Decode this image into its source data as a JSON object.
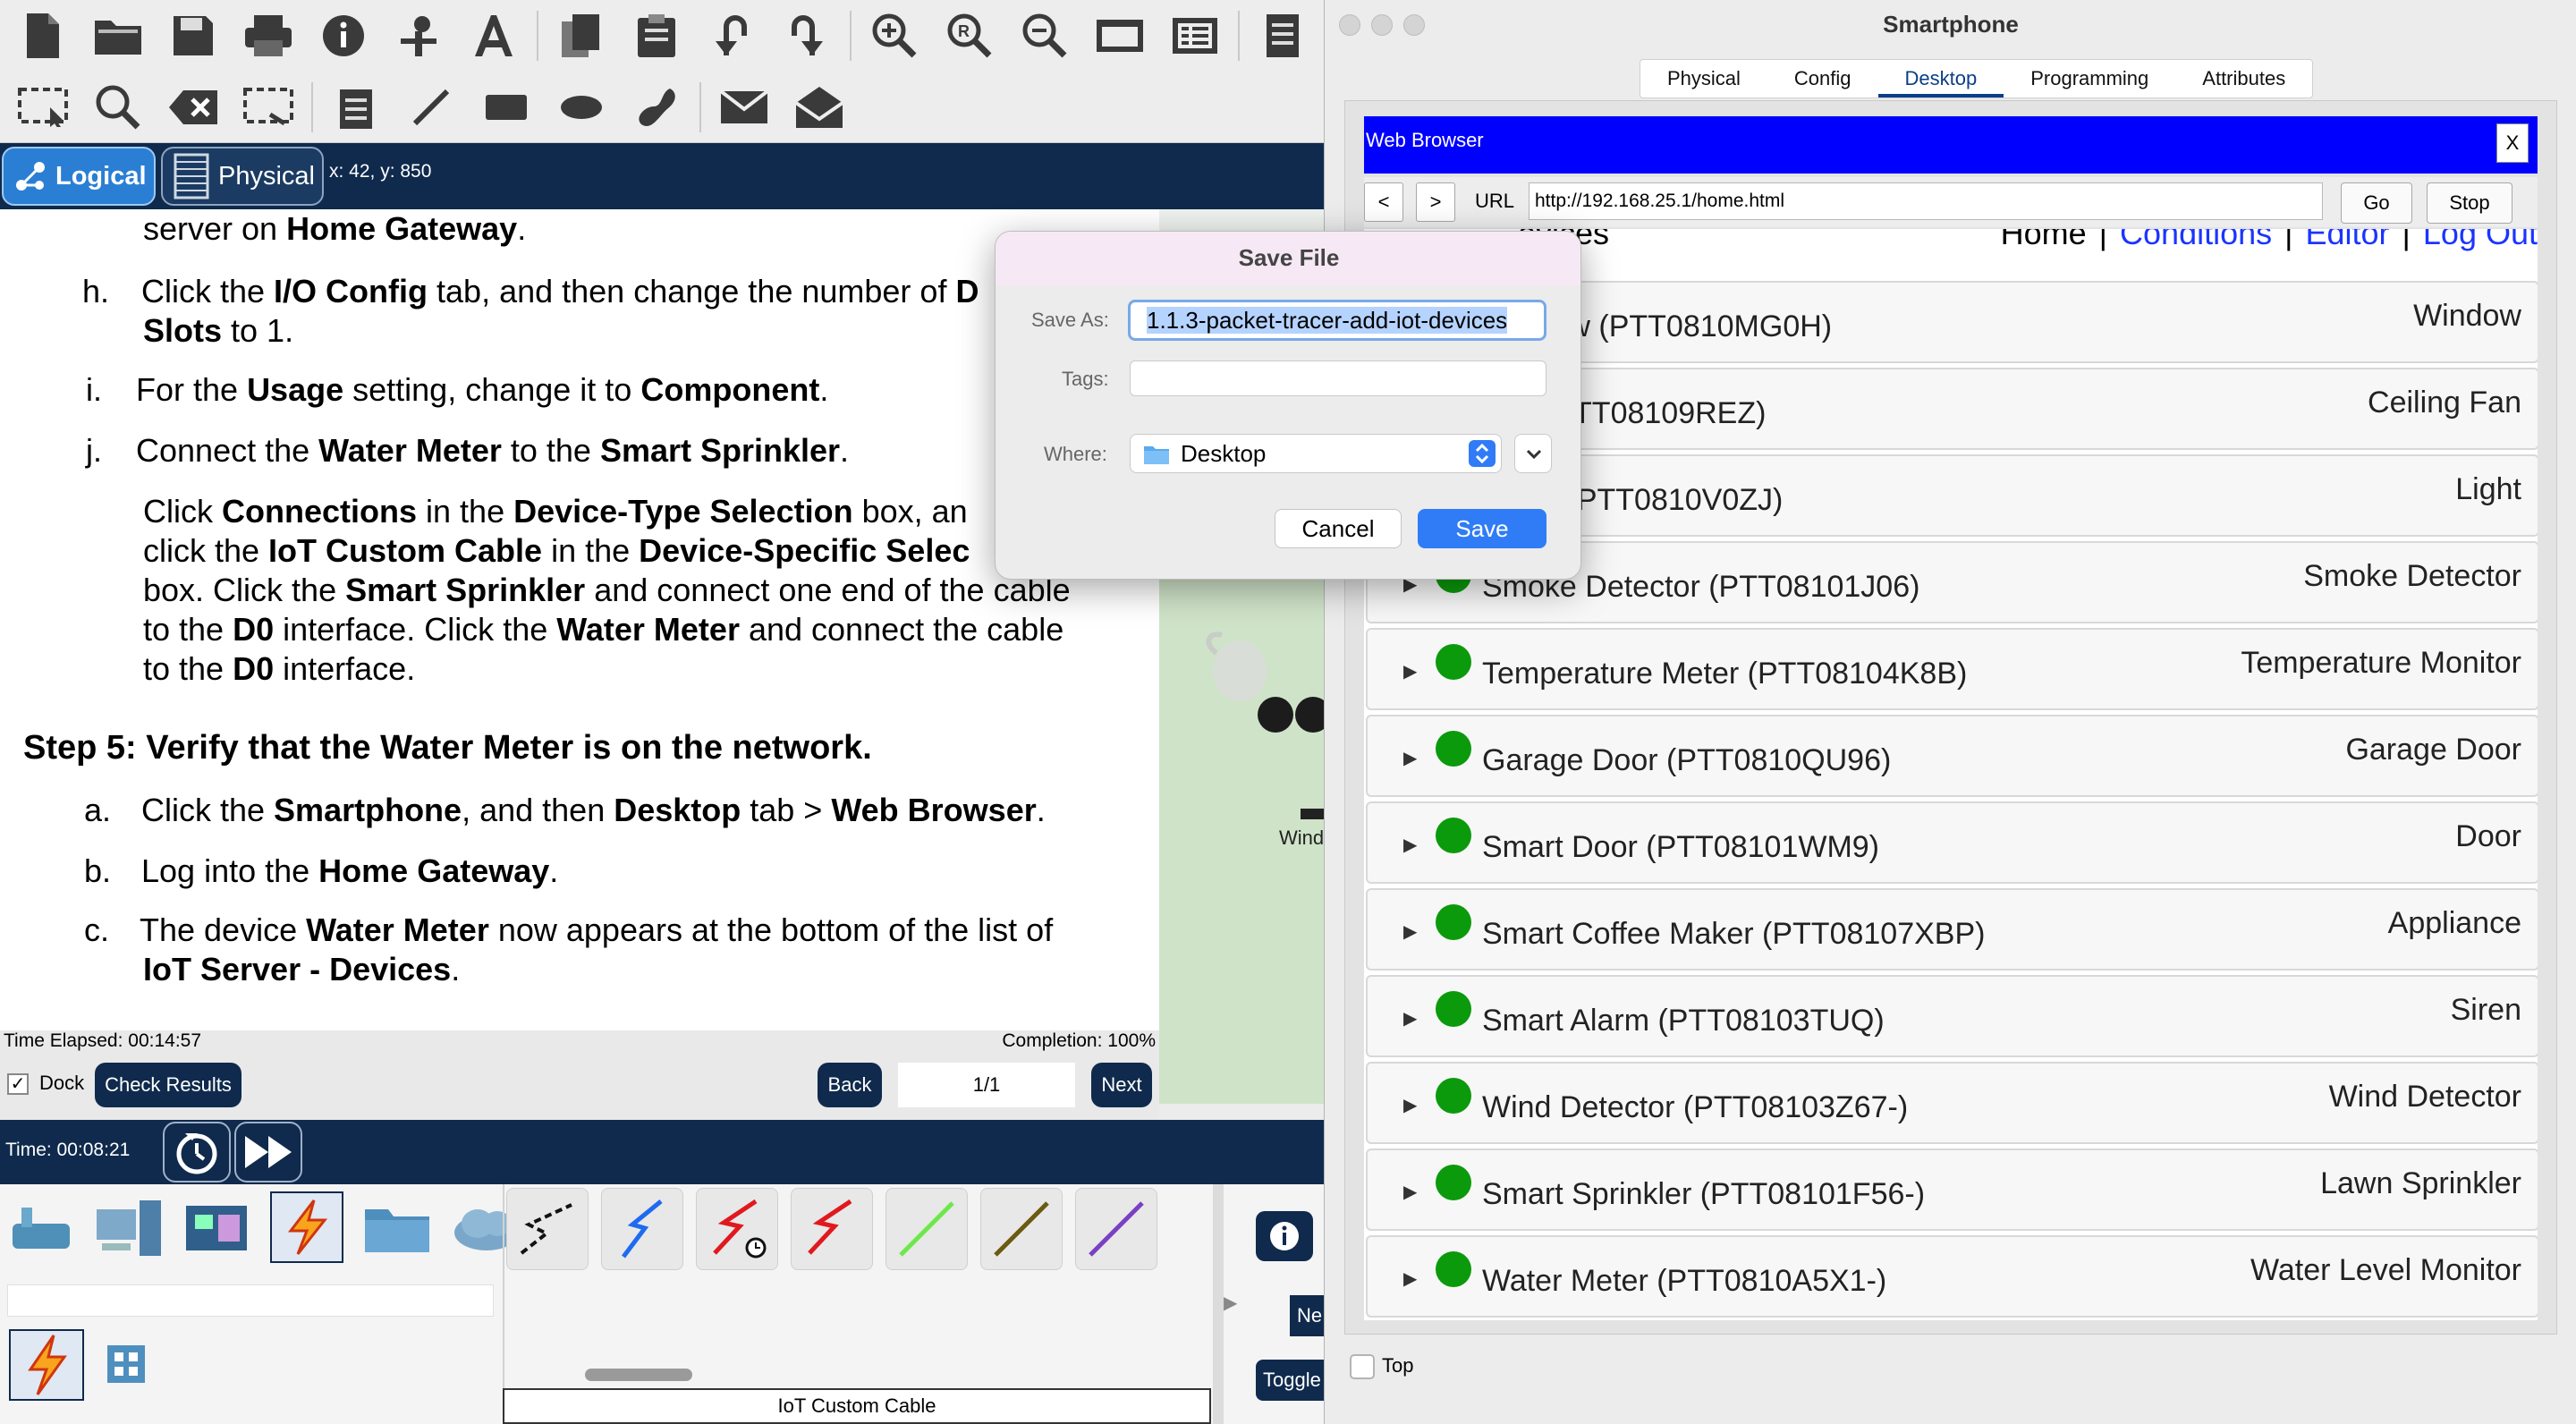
{
  "toolbar": {
    "row1_icons": [
      "new-file-icon",
      "open-folder-icon",
      "save-icon",
      "print-icon",
      "info-icon",
      "activity-wizard-icon",
      "font-tool-icon",
      "copy-icon",
      "paste-icon",
      "undo-icon",
      "redo-icon",
      "zoom-in-icon",
      "zoom-reset-icon",
      "zoom-out-icon",
      "window-icon",
      "palette-icon",
      "note-icon"
    ],
    "row2_icons": [
      "select-icon",
      "inspect-icon",
      "delete-icon",
      "resize-icon",
      "note-tool-icon",
      "line-icon",
      "rectangle-icon",
      "ellipse-icon",
      "freeform-icon",
      "add-simple-pdu-icon",
      "add-complex-pdu-icon"
    ]
  },
  "navbar": {
    "logical_label": "Logical",
    "physical_label": "Physical",
    "coords": "x: 42, y: 850"
  },
  "instructions": {
    "l1a": "server on ",
    "l1b": "Home Gateway",
    "l1c": ".",
    "h_letter": "h.",
    "h_a": "Click the ",
    "h_b": "I/O Config",
    "h_c": " tab, and then change the number of ",
    "h_d": "D",
    "h2_a": "Slots",
    "h2_b": " to 1.",
    "i_letter": "i.",
    "i_a": "For the ",
    "i_b": "Usage",
    "i_c": " setting, change it to ",
    "i_d": "Component",
    "i_e": ".",
    "j_letter": "j.",
    "j_a": "Connect the ",
    "j_b": "Water Meter",
    "j_c": " to the ",
    "j_d": "Smart Sprinkler",
    "j_e": ".",
    "p1_a": "Click ",
    "p1_b": "Connections",
    "p1_c": " in the ",
    "p1_d": "Device-Type Selection",
    "p1_e": " box, an",
    "p2_a": "click the ",
    "p2_b": "IoT Custom Cable",
    "p2_c": " in the ",
    "p2_d": "Device-Specific Selec",
    "p3_a": "box. Click the ",
    "p3_b": "Smart Sprinkler",
    "p3_c": " and connect one end of the cable",
    "p4_a": "to the ",
    "p4_b": "D0",
    "p4_c": " interface. Click the ",
    "p4_d": "Water Meter",
    "p4_e": " and connect the cable",
    "p5_a": "to the ",
    "p5_b": "D0",
    "p5_c": " interface.",
    "step5": "Step 5: Verify that the Water Meter is on the network.",
    "a_letter": "a.",
    "a_a": "Click the ",
    "a_b": "Smartphone",
    "a_c": ", and then ",
    "a_d": "Desktop",
    "a_e": " tab > ",
    "a_f": "Web Browser",
    "a_g": ".",
    "b_letter": "b.",
    "b_a": "Log into the ",
    "b_b": "Home Gateway",
    "b_c": ".",
    "c_letter": "c.",
    "c_a": "The device ",
    "c_b": "Water Meter",
    "c_c": " now appears at the bottom of the list of",
    "c2_a": "IoT Server - Devices",
    "c2_b": "."
  },
  "canvas": {
    "label_wind": "Wind"
  },
  "status": {
    "time_elapsed": "Time Elapsed: 00:14:57",
    "completion": "Completion: 100%",
    "dock_label": "Dock",
    "check_results": "Check Results",
    "back": "Back",
    "page": "1/1",
    "next": "Next"
  },
  "timebar": {
    "time": "Time: 00:08:21"
  },
  "bottom": {
    "cable_label": "IoT Custom Cable",
    "side_new": "Ne",
    "side_toggle": "Toggle"
  },
  "smartphone": {
    "title": "Smartphone",
    "tabs": [
      "Physical",
      "Config",
      "Desktop",
      "Programming",
      "Attributes"
    ],
    "active_tab": "Desktop",
    "browser_title": "Web Browser",
    "close_label": "X",
    "back_label": "<",
    "forward_label": ">",
    "url_label": "URL",
    "url": "http://192.168.25.1/home.html",
    "go_label": "Go",
    "stop_label": "Stop",
    "page_heading": "evices",
    "nav_home": "Home",
    "nav_conditions": "Conditions",
    "nav_editor": "Editor",
    "nav_logout": "Log Out",
    "devices": [
      {
        "name": "Window (PTT0810MG0H)",
        "type": "Window"
      },
      {
        "name": "Fan (PTT08109REZ)",
        "type": "Ceiling Fan"
      },
      {
        "name": "Lamp (PTT0810V0ZJ)",
        "type": "Light"
      },
      {
        "name": "Smoke Detector (PTT08101J06)",
        "type": "Smoke Detector"
      },
      {
        "name": "Temperature Meter (PTT08104K8B)",
        "type": "Temperature Monitor"
      },
      {
        "name": "Garage Door (PTT0810QU96)",
        "type": "Garage Door"
      },
      {
        "name": "Smart Door (PTT08101WM9)",
        "type": "Door"
      },
      {
        "name": "Smart Coffee Maker (PTT08107XBP)",
        "type": "Appliance"
      },
      {
        "name": "Smart Alarm (PTT08103TUQ)",
        "type": "Siren"
      },
      {
        "name": "Wind Detector (PTT08103Z67-)",
        "type": "Wind Detector"
      },
      {
        "name": "Smart Sprinkler (PTT08101F56-)",
        "type": "Lawn Sprinkler"
      },
      {
        "name": "Water Meter (PTT0810A5X1-)",
        "type": "Water Level Monitor"
      }
    ],
    "top_label": "Top"
  },
  "save_dialog": {
    "title": "Save File",
    "save_as_label": "Save As:",
    "save_as_value": "1.1.3-packet-tracer-add-iot-devices",
    "tags_label": "Tags:",
    "where_label": "Where:",
    "where_value": "Desktop",
    "cancel": "Cancel",
    "save": "Save"
  },
  "colors": {
    "navy": "#0f2a4c",
    "browser_blue": "#0000ff",
    "link_blue": "#1a35ff",
    "status_green": "#0b9a0b",
    "mac_blue": "#2f7cf6"
  }
}
